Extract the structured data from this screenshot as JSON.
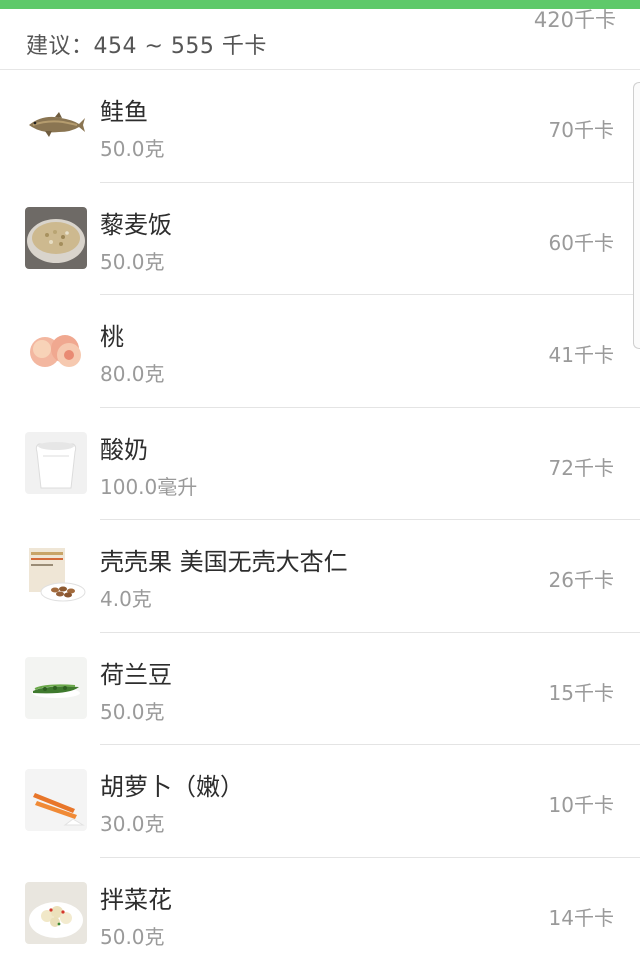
{
  "header": {
    "suggestion": "建议：454 ~ 555 千卡",
    "previous_total": "420千卡"
  },
  "colors": {
    "accent": "#5ec96a",
    "text_primary": "#2d2d2d",
    "text_secondary": "#9a9a9a"
  },
  "items": [
    {
      "name": "鲑鱼",
      "amount": "50.0克",
      "kcal": "70千卡",
      "icon": "salmon-image"
    },
    {
      "name": "藜麦饭",
      "amount": "50.0克",
      "kcal": "60千卡",
      "icon": "quinoa-rice-image"
    },
    {
      "name": "桃",
      "amount": "80.0克",
      "kcal": "41千卡",
      "icon": "peach-image"
    },
    {
      "name": "酸奶",
      "amount": "100.0毫升",
      "kcal": "72千卡",
      "icon": "yogurt-image"
    },
    {
      "name": "壳壳果 美国无壳大杏仁",
      "amount": "4.0克",
      "kcal": "26千卡",
      "icon": "almond-image"
    },
    {
      "name": "荷兰豆",
      "amount": "50.0克",
      "kcal": "15千卡",
      "icon": "snow-pea-image"
    },
    {
      "name": "胡萝卜（嫩）",
      "amount": "30.0克",
      "kcal": "10千卡",
      "icon": "carrot-image"
    },
    {
      "name": "拌菜花",
      "amount": "50.0克",
      "kcal": "14千卡",
      "icon": "cauliflower-salad-image"
    }
  ]
}
